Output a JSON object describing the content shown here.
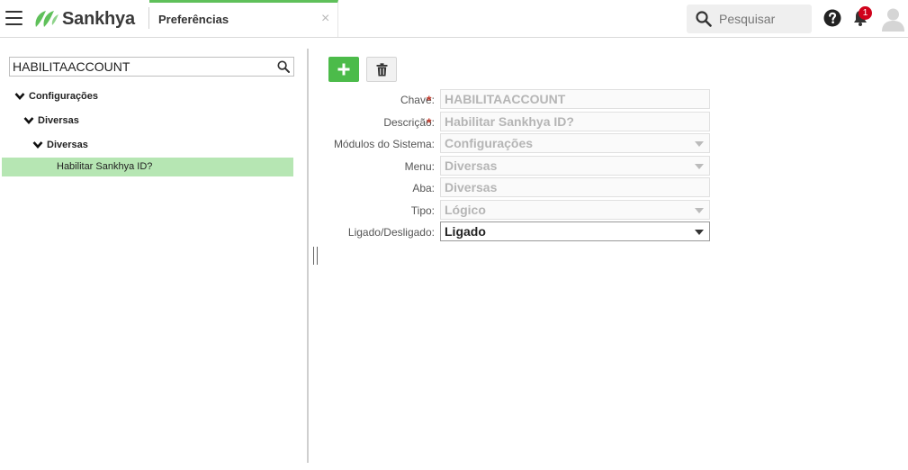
{
  "header": {
    "brand": "Sankhya",
    "tab_label": "Preferências",
    "tab_close": "×",
    "search_placeholder": "Pesquisar",
    "notification_count": "1",
    "brand_color": "#5fc05a"
  },
  "tree": {
    "search_value": "HABILITAACCOUNT",
    "nodes": [
      {
        "label": "Configurações"
      },
      {
        "label": "Diversas"
      },
      {
        "label": "Diversas"
      }
    ],
    "selected_leaf": "Habilitar Sankhya ID?"
  },
  "form": {
    "fields": [
      {
        "label": "Chave:",
        "value": "HABILITAACCOUNT",
        "required": true
      },
      {
        "label": "Descrição:",
        "value": "Habilitar Sankhya ID?",
        "required": true
      },
      {
        "label": "Módulos do Sistema:",
        "value": "Configurações",
        "dropdown": true
      },
      {
        "label": "Menu:",
        "value": "Diversas",
        "dropdown": true
      },
      {
        "label": "Aba:",
        "value": "Diversas"
      },
      {
        "label": "Tipo:",
        "value": "Lógico",
        "dropdown": true
      },
      {
        "label": "Ligado/Desligado:",
        "value": "Ligado",
        "dropdown": true,
        "editable": true
      }
    ],
    "required_mark": "*"
  },
  "icons": {
    "menu": "hamburger-icon",
    "logo": "sankhya-leaf-icon",
    "search": "search-icon",
    "help": "help-icon",
    "notifications": "bell-icon",
    "user": "avatar-icon",
    "add": "plus-icon",
    "delete": "trash-icon"
  }
}
